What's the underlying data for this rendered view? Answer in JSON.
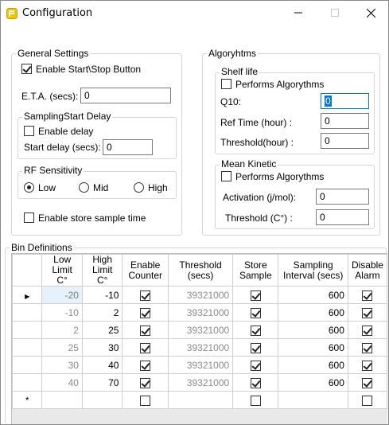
{
  "window": {
    "title": "Configuration",
    "icon": "app-logo-icon",
    "accent": "#0078d7"
  },
  "general": {
    "legend": "General Settings",
    "enable_start_stop": {
      "label": "Enable Start\\Stop Button",
      "checked": true
    },
    "eta_label": "E.T.A. (secs):",
    "eta_value": "0",
    "sampling_delay": {
      "legend": "SamplingStart Delay",
      "enable_delay": {
        "label": "Enable delay",
        "checked": false
      },
      "start_delay_label": "Start delay (secs):",
      "start_delay_value": "0"
    },
    "rf_sensitivity": {
      "legend": "RF Sensitivity",
      "options": [
        {
          "label": "Low",
          "selected": true
        },
        {
          "label": "Mid",
          "selected": false
        },
        {
          "label": "High",
          "selected": false
        }
      ]
    },
    "store_sample_time": {
      "label": "Enable store sample time",
      "checked": false
    }
  },
  "algorithms": {
    "legend": "Algoryhtms",
    "shelf_life": {
      "legend": "Shelf life",
      "performs": {
        "label": "Performs Algorythms",
        "checked": false
      },
      "q10_label": "Q10:",
      "q10_value": "0",
      "ref_time_label": "Ref Time (hour) :",
      "ref_time_value": "0",
      "threshold_label": "Threshold(hour) :",
      "threshold_value": "0"
    },
    "mean_kinetic": {
      "legend": "Mean Kinetic",
      "performs": {
        "label": "Performs Algorythms",
        "checked": false
      },
      "activation_label": "Activation  (j/mol):",
      "activation_value": "0",
      "threshold_label": "Threshold (C°) :",
      "threshold_value": "0"
    }
  },
  "bins": {
    "legend": "Bin Definitions",
    "columns": [
      "Low Limit C°",
      "High Limit C°",
      "Enable Counter",
      "Threshold (secs)",
      "Store Sample",
      "Sampling Interval (secs)",
      "Disable Alarm"
    ],
    "rows": [
      {
        "low": "-20",
        "high": "-10",
        "enable_counter": true,
        "threshold": "39321000",
        "store_sample": true,
        "interval": "600",
        "disable_alarm": true
      },
      {
        "low": "-10",
        "high": "2",
        "enable_counter": true,
        "threshold": "39321000",
        "store_sample": true,
        "interval": "600",
        "disable_alarm": true
      },
      {
        "low": "2",
        "high": "25",
        "enable_counter": true,
        "threshold": "39321000",
        "store_sample": true,
        "interval": "600",
        "disable_alarm": true
      },
      {
        "low": "25",
        "high": "30",
        "enable_counter": true,
        "threshold": "39321000",
        "store_sample": true,
        "interval": "600",
        "disable_alarm": true
      },
      {
        "low": "30",
        "high": "40",
        "enable_counter": true,
        "threshold": "39321000",
        "store_sample": true,
        "interval": "600",
        "disable_alarm": true
      },
      {
        "low": "40",
        "high": "70",
        "enable_counter": true,
        "threshold": "39321000",
        "store_sample": true,
        "interval": "600",
        "disable_alarm": true
      }
    ],
    "current_row_marker": "▶",
    "new_row_marker": "*"
  }
}
